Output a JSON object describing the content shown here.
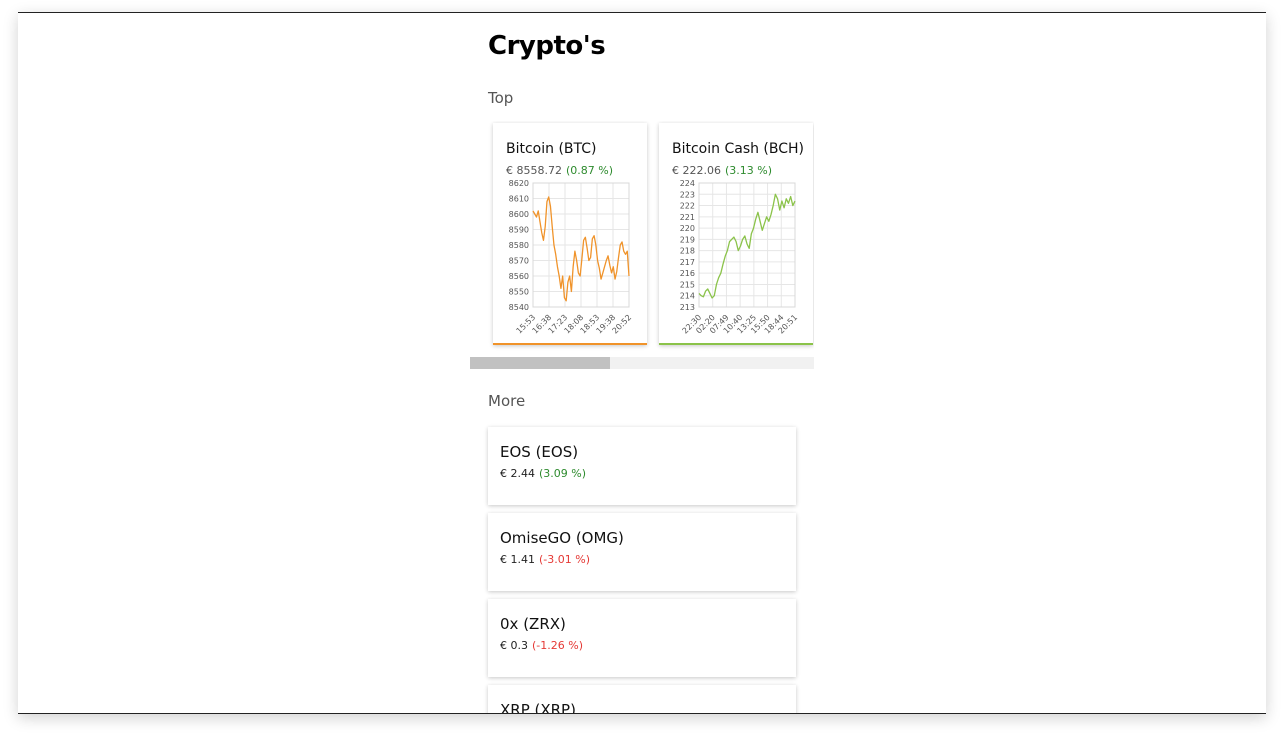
{
  "page": {
    "title": "Crypto's"
  },
  "sections": {
    "top_label": "Top",
    "more_label": "More"
  },
  "colors": {
    "btc_line": "#f0932a",
    "bch_line": "#8bc34a",
    "positive": "#2e8b2e",
    "negative": "#e53935"
  },
  "top_cards": [
    {
      "name": "Bitcoin (BTC)",
      "price": "€ 8558.72",
      "change": "(0.87 %)",
      "change_dir": "positive"
    },
    {
      "name": "Bitcoin Cash (BCH)",
      "price": "€ 222.06",
      "change": "(3.13 %)",
      "change_dir": "positive"
    }
  ],
  "chart_data": [
    {
      "type": "line",
      "title": "",
      "y_ticks": [
        "8620",
        "8610",
        "8600",
        "8590",
        "8580",
        "8570",
        "8560",
        "8550",
        "8540"
      ],
      "x_ticks": [
        "15:53",
        "16:38",
        "17:23",
        "18:08",
        "18:53",
        "19:38",
        "20:52"
      ],
      "ylim": [
        8540,
        8620
      ],
      "grid": true,
      "series": [
        {
          "color": "#f0932a",
          "values": [
            8602,
            8600,
            8598,
            8602,
            8595,
            8588,
            8583,
            8592,
            8608,
            8611,
            8605,
            8592,
            8580,
            8574,
            8566,
            8560,
            8552,
            8560,
            8546,
            8544,
            8556,
            8560,
            8550,
            8566,
            8576,
            8570,
            8562,
            8560,
            8571,
            8583,
            8585,
            8578,
            8570,
            8572,
            8584,
            8586,
            8580,
            8570,
            8565,
            8558,
            8562,
            8566,
            8570,
            8573,
            8567,
            8562,
            8566,
            8558,
            8563,
            8572,
            8580,
            8582,
            8576,
            8574,
            8576,
            8560
          ]
        }
      ]
    },
    {
      "type": "line",
      "title": "",
      "y_ticks": [
        "224",
        "223",
        "222",
        "221",
        "220",
        "219",
        "218",
        "217",
        "216",
        "215",
        "214",
        "213"
      ],
      "x_ticks": [
        "22:30",
        "02:20",
        "07:49",
        "10:40",
        "13:25",
        "15:50",
        "18:44",
        "20:51"
      ],
      "ylim": [
        213,
        224
      ],
      "grid": true,
      "series": [
        {
          "color": "#8bc34a",
          "values": [
            214.2,
            214.0,
            213.9,
            214.4,
            214.6,
            214.2,
            213.8,
            214.0,
            215.0,
            215.6,
            216.0,
            216.8,
            217.5,
            218.0,
            218.8,
            219.0,
            219.2,
            218.8,
            218.0,
            218.4,
            219.0,
            219.3,
            218.6,
            218.2,
            219.5,
            220.0,
            220.8,
            221.4,
            220.6,
            219.8,
            220.4,
            221.0,
            220.6,
            221.2,
            222.0,
            223.0,
            222.6,
            221.6,
            222.4,
            221.8,
            222.6,
            222.2,
            222.8,
            222.0,
            222.4
          ]
        }
      ]
    }
  ],
  "more_items": [
    {
      "name": "EOS (EOS)",
      "price": "€ 2.44",
      "change": "(3.09 %)",
      "change_dir": "positive"
    },
    {
      "name": "OmiseGO (OMG)",
      "price": "€ 1.41",
      "change": "(-3.01 %)",
      "change_dir": "negative"
    },
    {
      "name": "0x (ZRX)",
      "price": "€ 0.3",
      "change": "(-1.26 %)",
      "change_dir": "negative"
    },
    {
      "name": "XRP (XRP)",
      "price": "",
      "change": "",
      "change_dir": "positive"
    }
  ]
}
